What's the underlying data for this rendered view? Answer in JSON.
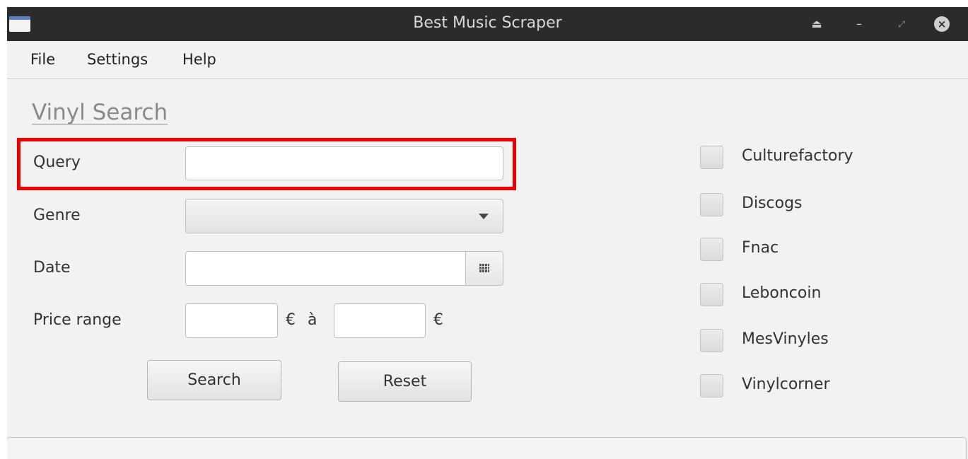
{
  "window": {
    "title": "Best Music Scraper"
  },
  "titlebar": {
    "eject_glyph": "⏏",
    "minimize_glyph": "–",
    "maximize_glyph": "⤢",
    "close_glyph": "×"
  },
  "menubar": {
    "items": [
      {
        "label": "File"
      },
      {
        "label": "Settings"
      },
      {
        "label": "Help"
      }
    ]
  },
  "form": {
    "section_title": "Vinyl Search",
    "query_label": "Query",
    "query_value": "",
    "genre_label": "Genre",
    "genre_selected": "",
    "date_label": "Date",
    "date_value": "",
    "price_label": "Price range",
    "price_min_value": "",
    "price_max_value": "",
    "currency": "€",
    "range_separator": "à",
    "search_button": "Search",
    "reset_button": "Reset"
  },
  "sites": [
    {
      "label": "Culturefactory",
      "checked": false
    },
    {
      "label": "Discogs",
      "checked": false
    },
    {
      "label": "Fnac",
      "checked": false
    },
    {
      "label": "Leboncoin",
      "checked": false
    },
    {
      "label": "MesVinyles",
      "checked": false
    },
    {
      "label": "Vinylcorner",
      "checked": false
    }
  ],
  "colors": {
    "highlight": "#ee0000",
    "titlebar_bg": "#2b2b2b",
    "window_bg": "#f2f2f2",
    "section_title": "#8a8a8a"
  }
}
